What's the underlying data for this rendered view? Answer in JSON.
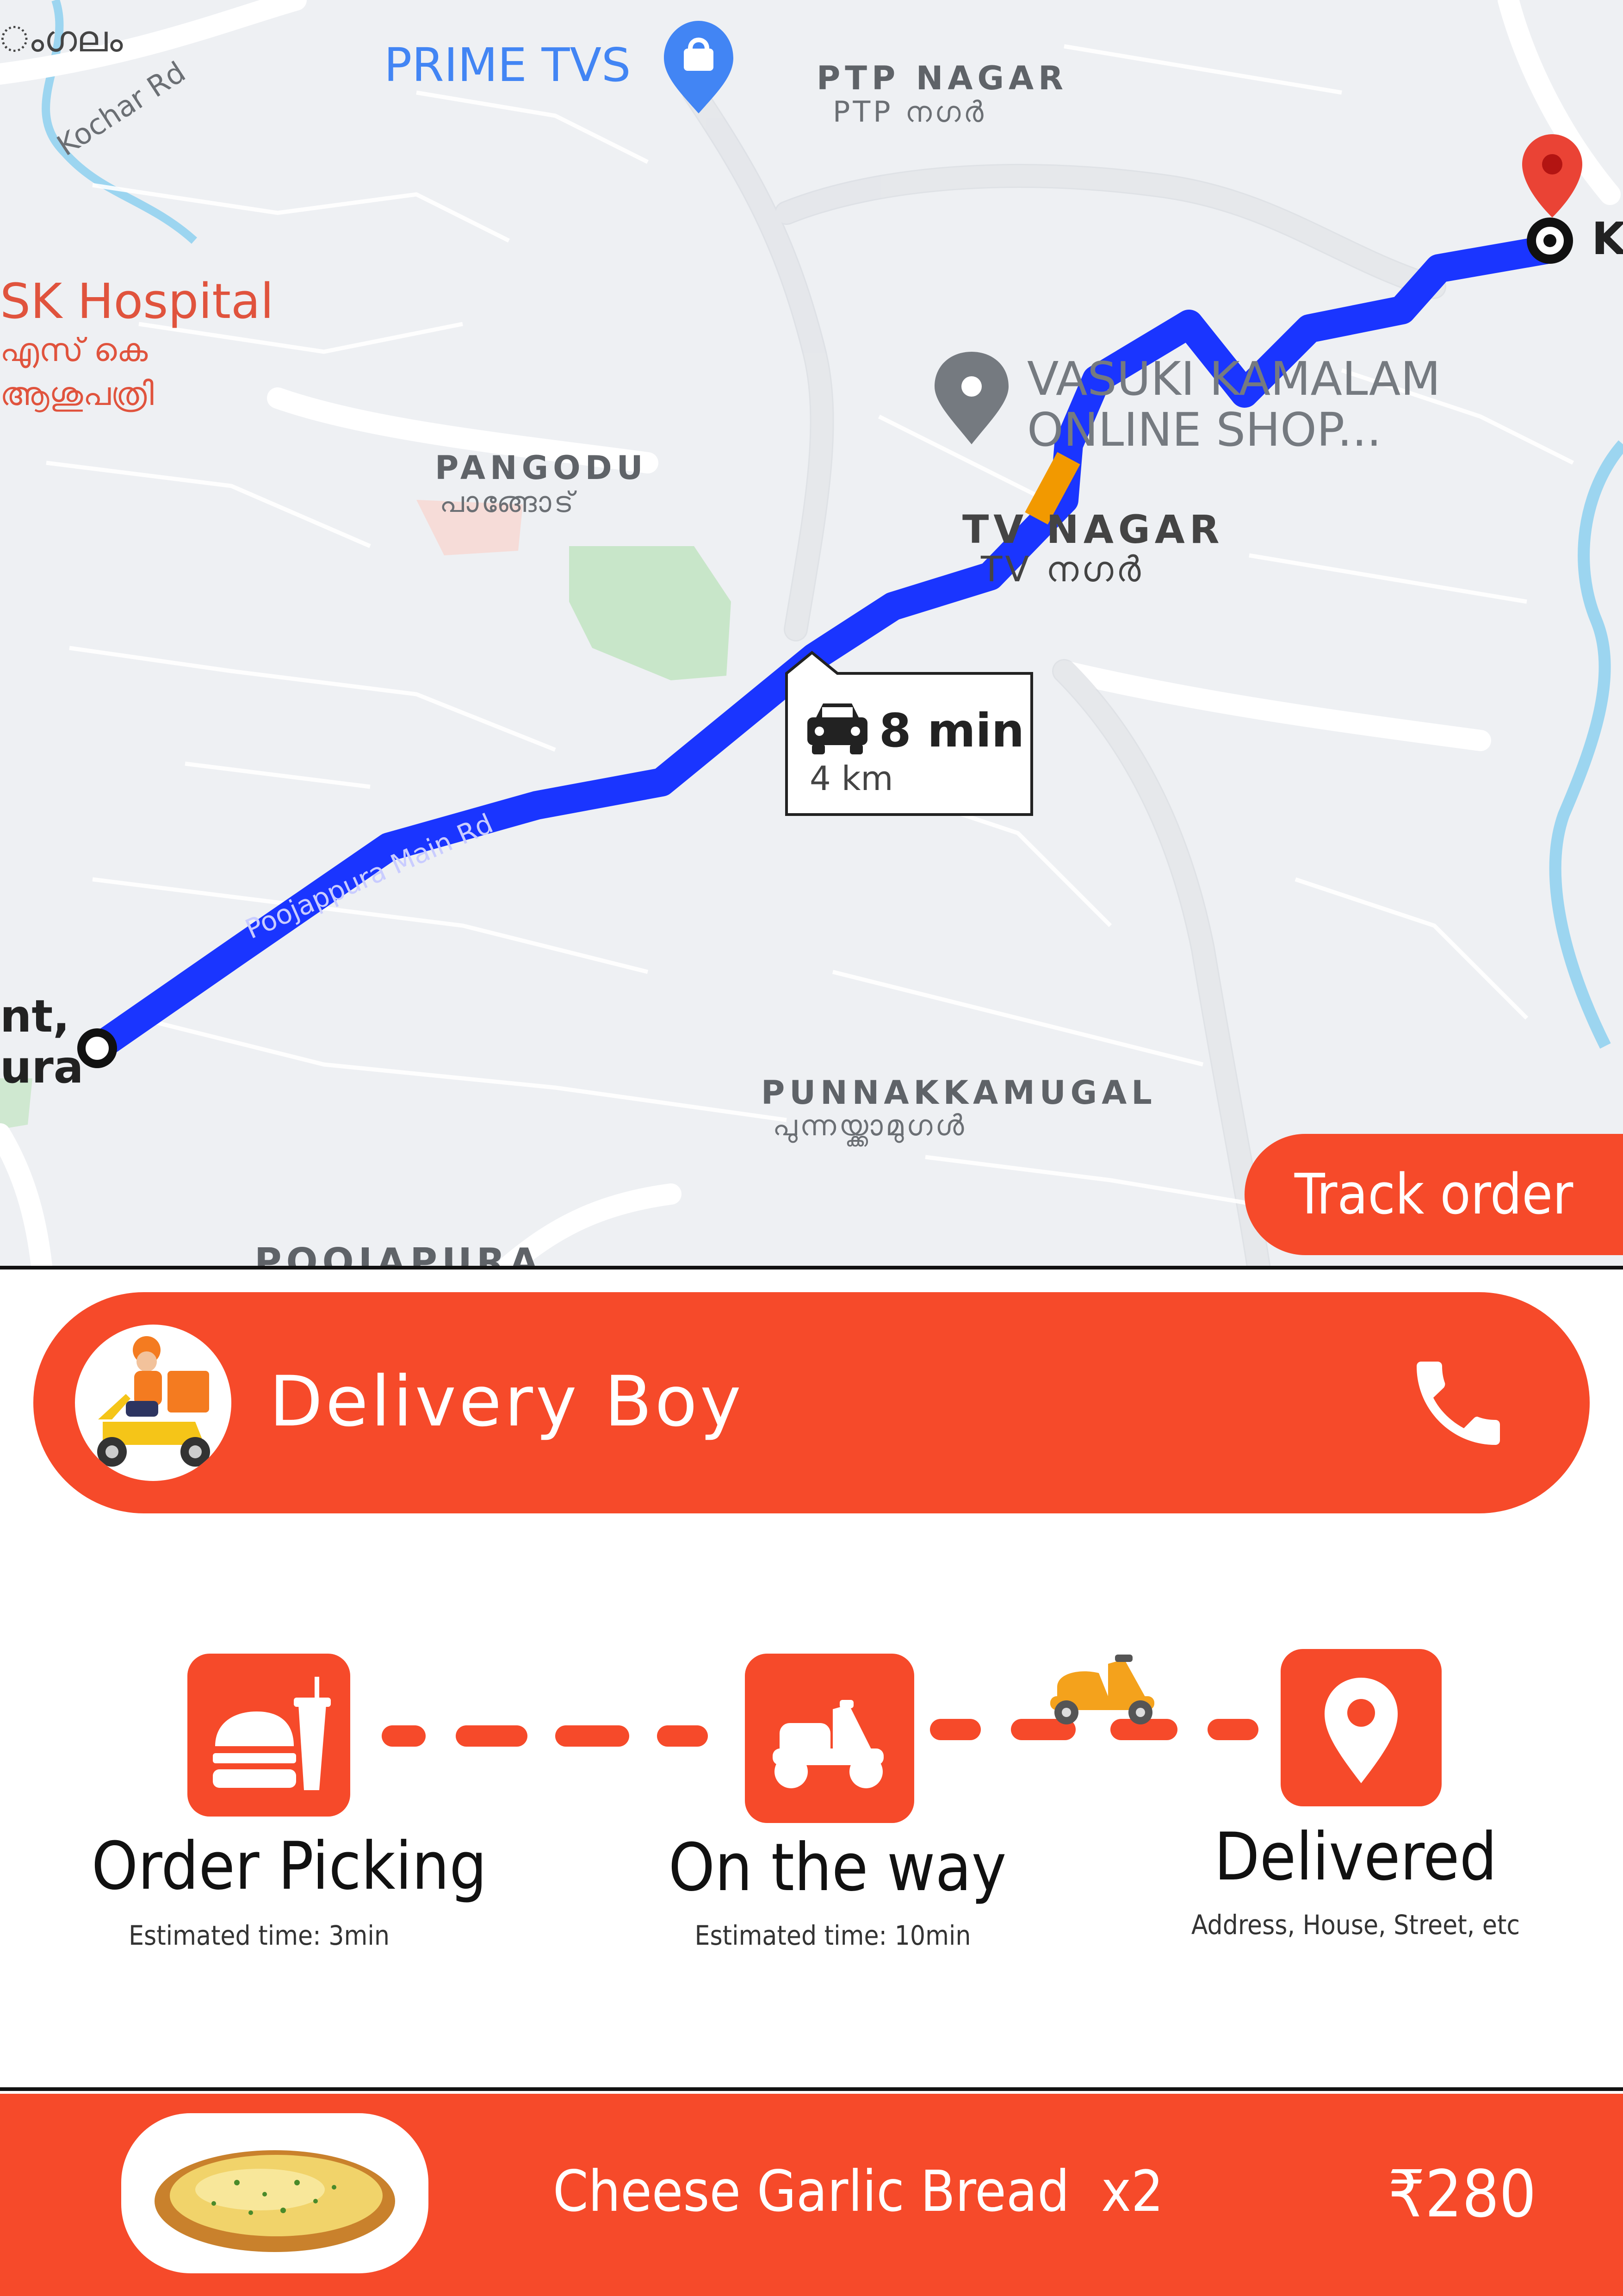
{
  "map": {
    "places": {
      "prime_tvs": "PRIME TVS",
      "ptp_nagar": "PTP NAGAR",
      "ptp_nagar_ml": "PTP നഗർ",
      "sk_hospital": "SK Hospital",
      "sk_hospital_ml1": "എസ് കെ",
      "sk_hospital_ml2": "ആശുപത്രി",
      "kochar_rd": "Kochar Rd",
      "pangodu": "PANGODU",
      "pangodu_ml": "പാങ്ങോട്",
      "vasuki_1": "VASUKI KAMALAM",
      "vasuki_2": "ONLINE SHOP...",
      "tv_nagar": "TV NAGAR",
      "tv_nagar_ml": "TV നഗർ",
      "poojappura_rd": "Poojappura Main Rd",
      "punnakkamugal": "PUNNAKKAMUGAL",
      "punnakkamugal_ml": "പുന്നയ്ക്കാമുഗൾ",
      "poojapura": "POOJAPURA",
      "edge_top": "ംഗലം",
      "edge_right": "K",
      "edge_left1": "nt,",
      "edge_left2": "ura"
    },
    "route_info": {
      "time": "8 min",
      "distance": "4 km"
    },
    "colors": {
      "route": "#1a35ff",
      "traffic": "#f29900",
      "pin": "#ea4335"
    }
  },
  "track_button": "Track order",
  "delivery": {
    "name": "Delivery Boy",
    "avatar_icon": "scooter-rider-icon",
    "call_icon": "phone-icon"
  },
  "steps": [
    {
      "title": "Order Picking",
      "subtitle": "Estimated time: 3min",
      "icon": "burger-drink-icon"
    },
    {
      "title": "On the way",
      "subtitle": "Estimated time: 10min",
      "icon": "scooter-icon"
    },
    {
      "title": "Delivered",
      "subtitle": "Address, House, Street, etc",
      "icon": "location-pin-icon"
    }
  ],
  "order": {
    "item": "Cheese Garlic Bread",
    "qty": "x2",
    "price": "₹280",
    "image_icon": "garlic-bread-icon"
  },
  "colors": {
    "accent": "#f64a2a",
    "text": "#111111",
    "white": "#ffffff"
  }
}
